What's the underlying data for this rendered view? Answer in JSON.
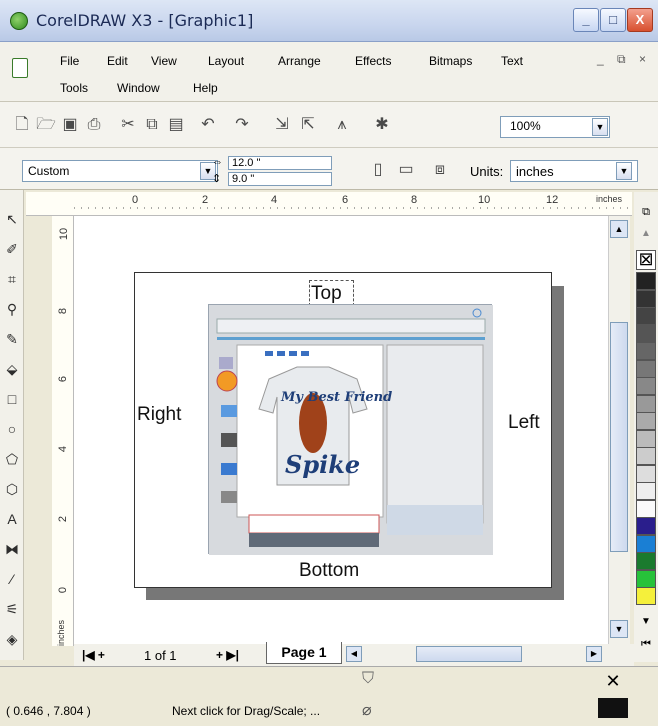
{
  "window": {
    "title": "CorelDRAW X3 - [Graphic1]",
    "min_label": "_",
    "max_label": "□",
    "close_label": "X"
  },
  "menubar": {
    "items": [
      "File",
      "Edit",
      "View",
      "Layout",
      "Arrange",
      "Effects",
      "Bitmaps",
      "Text",
      "Tools",
      "Window",
      "Help"
    ],
    "mdi": [
      "_",
      "⧉",
      "×"
    ]
  },
  "toolbar": {
    "zoom": "100%"
  },
  "propertybar": {
    "preset": "Custom",
    "width": "12.0 \"",
    "height": "9.0 \"",
    "units_label": "Units:",
    "units_value": "inches"
  },
  "ruler": {
    "top_ticks": [
      "0",
      "2",
      "4",
      "6",
      "8",
      "10",
      "12"
    ],
    "unit": "inches",
    "left_ticks": [
      "10",
      "8",
      "6",
      "4",
      "2",
      "0"
    ],
    "left_unit": "inches"
  },
  "canvas": {
    "top": "Top",
    "right": "Right",
    "left": "Left",
    "bottom": "Bottom"
  },
  "navigator": {
    "pages": "1 of 1",
    "tab": "Page 1"
  },
  "status": {
    "coords": "( 0.646 , 7.804 )",
    "hint": "Next click for Drag/Scale; ..."
  },
  "colors": {
    "palette": [
      "#ffffff",
      "#222222",
      "#333333",
      "#444444",
      "#555555",
      "#666666",
      "#777777",
      "#888888",
      "#999999",
      "#aaaaaa",
      "#bbbbbb",
      "#cccccc",
      "#dddddd",
      "#eeeeee",
      "#fafafa",
      "#2a1e8c",
      "#1a7fd4",
      "#1a7a2e",
      "#27c23a",
      "#f5f03b"
    ]
  }
}
